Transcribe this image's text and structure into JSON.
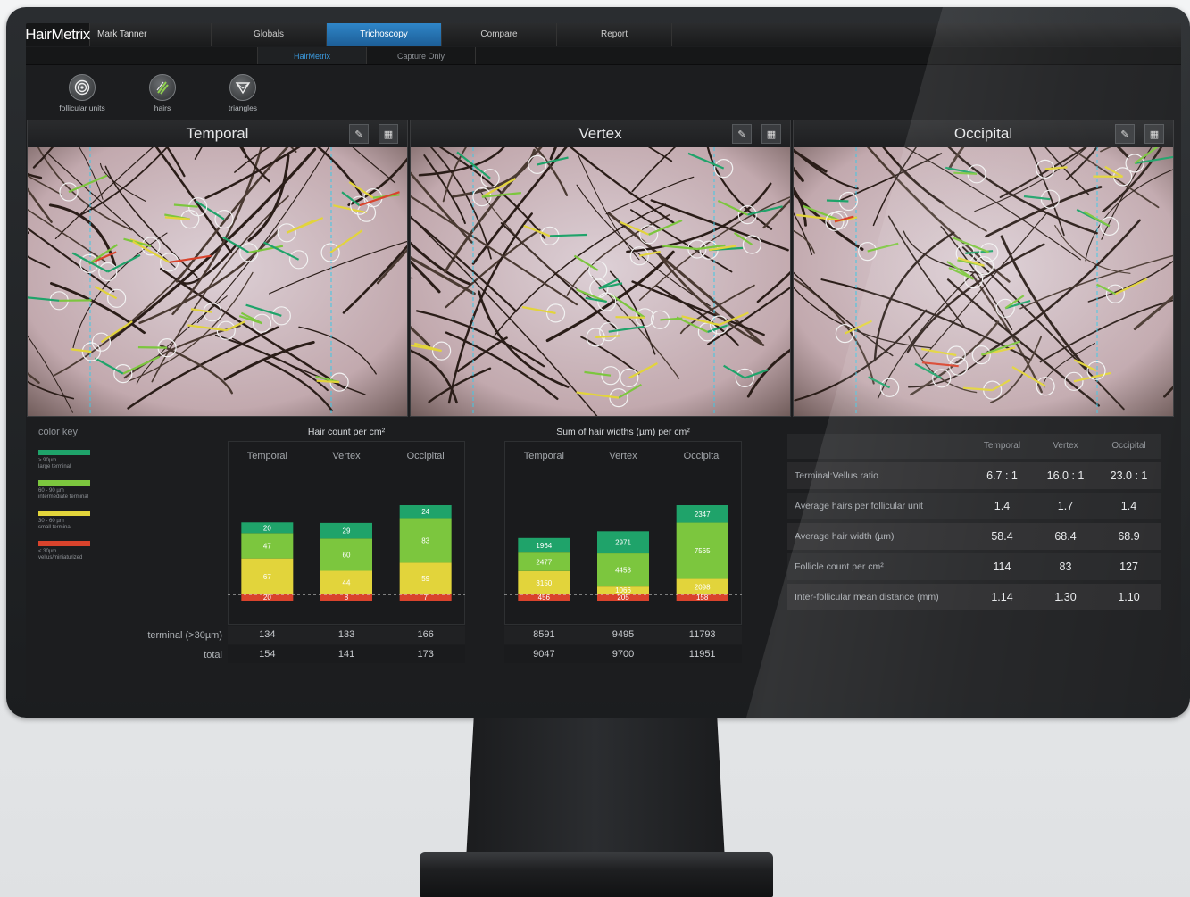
{
  "app": {
    "brand": "HairMetrix",
    "user": "Mark Tanner"
  },
  "nav": {
    "tabs": [
      {
        "label": "Globals"
      },
      {
        "label": "Trichoscopy",
        "active": true
      },
      {
        "label": "Compare"
      },
      {
        "label": "Report"
      }
    ],
    "subtabs": [
      {
        "label": "HairMetrix",
        "active": true
      },
      {
        "label": "Capture Only"
      }
    ]
  },
  "toolbar": {
    "tools": [
      {
        "label": "follicular units",
        "icon": "concentric-circles-icon"
      },
      {
        "label": "hairs",
        "icon": "hair-strands-icon"
      },
      {
        "label": "triangles",
        "icon": "triangle-icon"
      }
    ]
  },
  "panels": [
    {
      "title": "Temporal",
      "edit_icon": "edit-icon",
      "analyze_icon": "chart-icon"
    },
    {
      "title": "Vertex",
      "edit_icon": "edit-icon",
      "analyze_icon": "chart-icon"
    },
    {
      "title": "Occipital",
      "edit_icon": "edit-icon",
      "analyze_icon": "chart-icon"
    }
  ],
  "color_key": {
    "title": "color key",
    "items": [
      {
        "color": "#1fa36a",
        "line1": "> 90µm",
        "line2": "large terminal"
      },
      {
        "color": "#7cc63e",
        "line1": "60 - 90 µm",
        "line2": "intermediate terminal"
      },
      {
        "color": "#e2d43b",
        "line1": "30 - 60 µm",
        "line2": "small terminal"
      },
      {
        "color": "#d9432c",
        "line1": "< 30µm",
        "line2": "vellus/miniaturized"
      }
    ]
  },
  "row_labels": {
    "terminal": "terminal (>30µm)",
    "total": "total"
  },
  "chart_data": [
    {
      "type": "bar",
      "title": "Hair count per cm²",
      "categories": [
        "Temporal",
        "Vertex",
        "Occipital"
      ],
      "series": [
        {
          "color": "#d9432c",
          "values": [
            20,
            8,
            7
          ]
        },
        {
          "color": "#e2d43b",
          "values": [
            67,
            44,
            59
          ]
        },
        {
          "color": "#7cc63e",
          "values": [
            47,
            60,
            83
          ]
        },
        {
          "color": "#1fa36a",
          "values": [
            20,
            29,
            24
          ]
        }
      ],
      "terminal": [
        134,
        133,
        166
      ],
      "total": [
        154,
        141,
        173
      ]
    },
    {
      "type": "bar",
      "title": "Sum of hair widths (µm) per cm²",
      "categories": [
        "Temporal",
        "Vertex",
        "Occipital"
      ],
      "series": [
        {
          "color": "#d9432c",
          "values": [
            456,
            205,
            158
          ]
        },
        {
          "color": "#e2d43b",
          "values": [
            3150,
            1066,
            2098
          ]
        },
        {
          "color": "#7cc63e",
          "values": [
            2477,
            4453,
            7565
          ]
        },
        {
          "color": "#1fa36a",
          "values": [
            1964,
            2971,
            2347
          ]
        }
      ],
      "terminal": [
        8591,
        9495,
        11793
      ],
      "total": [
        9047,
        9700,
        11951
      ]
    }
  ],
  "stats": {
    "columns": [
      "Temporal",
      "Vertex",
      "Occipital"
    ],
    "rows": [
      {
        "label": "Terminal:Vellus ratio",
        "values": [
          "6.7 : 1",
          "16.0 : 1",
          "23.0 : 1"
        ]
      },
      {
        "label": "Average hairs per follicular unit",
        "values": [
          "1.4",
          "1.7",
          "1.4"
        ]
      },
      {
        "label": "Average hair width (µm)",
        "values": [
          "58.4",
          "68.4",
          "68.9"
        ]
      },
      {
        "label": "Follicle count per cm²",
        "values": [
          "114",
          "83",
          "127"
        ]
      },
      {
        "label": "Inter-follicular mean distance (mm)",
        "values": [
          "1.14",
          "1.30",
          "1.10"
        ]
      }
    ]
  }
}
